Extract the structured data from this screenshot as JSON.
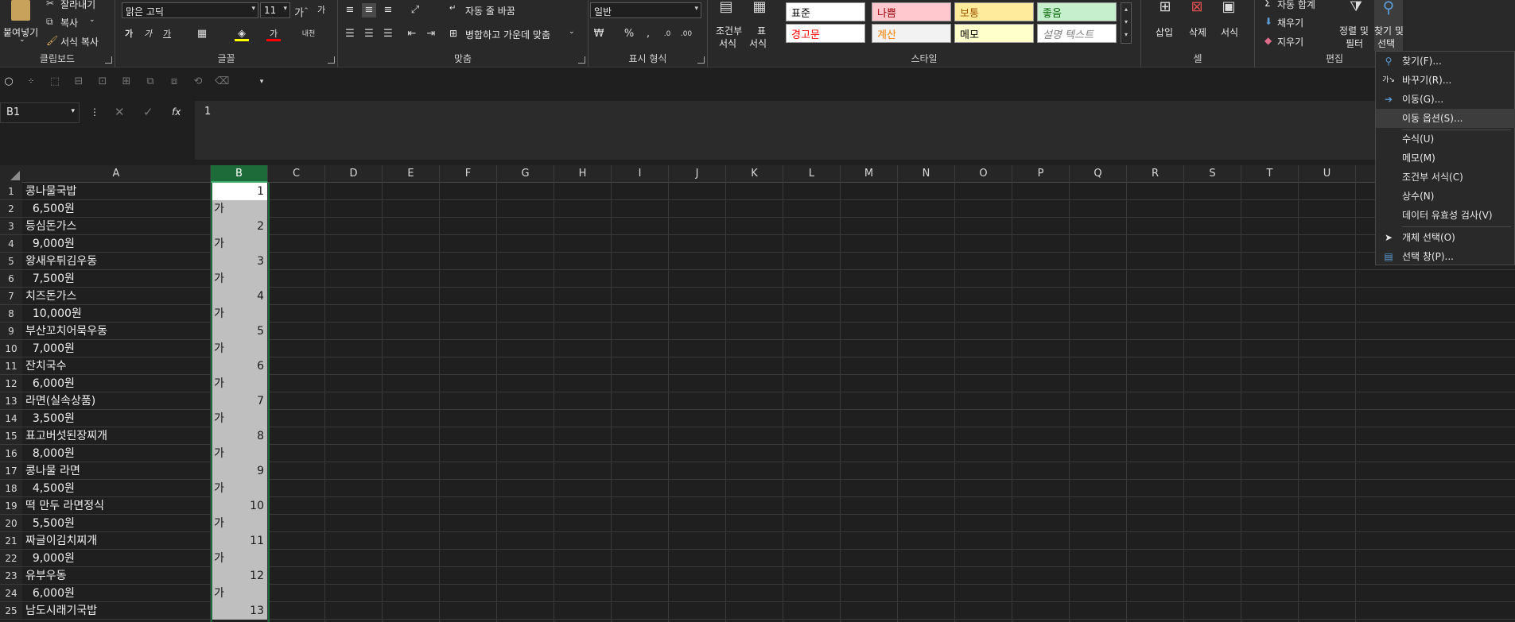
{
  "ribbon": {
    "clipboard": {
      "label": "클립보드",
      "paste": "붙여넣기",
      "cut": "잘라내기",
      "copy": "복사",
      "format_painter": "서식 복사"
    },
    "font": {
      "label": "글꼴",
      "font_name": "맑은 고딕",
      "font_size": "11"
    },
    "alignment": {
      "label": "맞춤",
      "wrap_text": "자동 줄 바꿈",
      "merge_center": "병합하고 가운데 맞춤"
    },
    "number": {
      "label": "표시 형식",
      "format": "일반"
    },
    "styles": {
      "label": "스타일",
      "conditional": "조건부",
      "conditional2": "서식",
      "table": "표",
      "table2": "서식",
      "cells": [
        {
          "text": "표준",
          "bg": "#ffffff",
          "fg": "#000000"
        },
        {
          "text": "나쁨",
          "bg": "#ffc7ce",
          "fg": "#9c0006"
        },
        {
          "text": "보통",
          "bg": "#ffeb9c",
          "fg": "#9c5700"
        },
        {
          "text": "좋음",
          "bg": "#c6efce",
          "fg": "#006100"
        },
        {
          "text": "경고문",
          "bg": "#ffffff",
          "fg": "#ff0000"
        },
        {
          "text": "계산",
          "bg": "#f2f2f2",
          "fg": "#fa7d00"
        },
        {
          "text": "메모",
          "bg": "#ffffcc",
          "fg": "#000000"
        },
        {
          "text": "설명 텍스트",
          "bg": "#ffffff",
          "fg": "#7f7f7f"
        }
      ]
    },
    "cells_group": {
      "label": "셀",
      "insert": "삽입",
      "delete": "삭제",
      "format": "서식"
    },
    "editing": {
      "label": "편집",
      "autosum": "자동 합계",
      "fill": "채우기",
      "clear": "지우기",
      "sort_filter": "정렬 및",
      "sort_filter2": "필터",
      "find_select": "찾기 및",
      "find_select2": "선택"
    }
  },
  "formula_bar": {
    "name_box": "B1",
    "fx": "fx",
    "value": "1"
  },
  "columns": [
    "A",
    "B",
    "C",
    "D",
    "E",
    "F",
    "G",
    "H",
    "I",
    "J",
    "K",
    "L",
    "M",
    "N",
    "O",
    "P",
    "Q",
    "R",
    "S",
    "T",
    "U"
  ],
  "rows": [
    {
      "n": "1",
      "a": "콩나물국밥",
      "b": "1"
    },
    {
      "n": "2",
      "a": "  6,500원",
      "b": "가"
    },
    {
      "n": "3",
      "a": "등심돈가스",
      "b": "2"
    },
    {
      "n": "4",
      "a": "  9,000원",
      "b": "가"
    },
    {
      "n": "5",
      "a": "왕새우튀김우동",
      "b": "3"
    },
    {
      "n": "6",
      "a": "  7,500원",
      "b": "가"
    },
    {
      "n": "7",
      "a": "치즈돈가스",
      "b": "4"
    },
    {
      "n": "8",
      "a": "  10,000원",
      "b": "가"
    },
    {
      "n": "9",
      "a": "부산꼬치어묵우동",
      "b": "5"
    },
    {
      "n": "10",
      "a": "  7,000원",
      "b": "가"
    },
    {
      "n": "11",
      "a": "잔치국수",
      "b": "6"
    },
    {
      "n": "12",
      "a": "  6,000원",
      "b": "가"
    },
    {
      "n": "13",
      "a": "라면(실속상품)",
      "b": "7"
    },
    {
      "n": "14",
      "a": "  3,500원",
      "b": "가"
    },
    {
      "n": "15",
      "a": "표고버섯된장찌개",
      "b": "8"
    },
    {
      "n": "16",
      "a": "  8,000원",
      "b": "가"
    },
    {
      "n": "17",
      "a": "콩나물 라면",
      "b": "9"
    },
    {
      "n": "18",
      "a": "  4,500원",
      "b": "가"
    },
    {
      "n": "19",
      "a": "떡 만두 라면정식",
      "b": "10"
    },
    {
      "n": "20",
      "a": "  5,500원",
      "b": "가"
    },
    {
      "n": "21",
      "a": "짜글이김치찌개",
      "b": "11"
    },
    {
      "n": "22",
      "a": "  9,000원",
      "b": "가"
    },
    {
      "n": "23",
      "a": "유부우동",
      "b": "12"
    },
    {
      "n": "24",
      "a": "  6,000원",
      "b": "가"
    },
    {
      "n": "25",
      "a": "남도시래기국밥",
      "b": "13"
    }
  ],
  "menu": {
    "find": "찾기(F)...",
    "replace": "바꾸기(R)...",
    "goto": "이동(G)...",
    "goto_special": "이동 옵션(S)...",
    "formulas": "수식(U)",
    "notes": "메모(M)",
    "conditional_formatting": "조건부 서식(C)",
    "constants": "상수(N)",
    "data_validation": "데이터 유효성 검사(V)",
    "select_objects": "개체 선택(O)",
    "selection_pane": "선택 창(P)..."
  }
}
